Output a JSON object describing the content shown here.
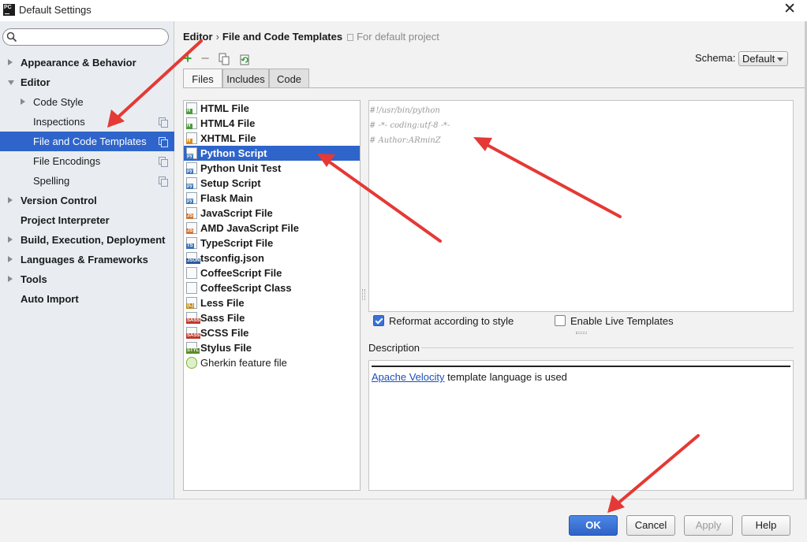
{
  "window": {
    "title": "Default Settings",
    "app_icon_text": "PC"
  },
  "search": {
    "placeholder": "",
    "value": ""
  },
  "sidebar": {
    "items": [
      {
        "label": "Appearance & Behavior",
        "level": 0,
        "expander": "right"
      },
      {
        "label": "Editor",
        "level": 0,
        "expander": "down"
      },
      {
        "label": "Code Style",
        "level": 1,
        "expander": "right"
      },
      {
        "label": "Inspections",
        "level": 1,
        "expander": "none",
        "copy_icon": true
      },
      {
        "label": "File and Code Templates",
        "level": 1,
        "expander": "none",
        "copy_icon": true,
        "selected": true
      },
      {
        "label": "File Encodings",
        "level": 1,
        "expander": "none",
        "copy_icon": true
      },
      {
        "label": "Spelling",
        "level": 1,
        "expander": "none",
        "copy_icon": true
      },
      {
        "label": "Version Control",
        "level": 0,
        "expander": "right"
      },
      {
        "label": "Project Interpreter",
        "level": 0,
        "expander": "none"
      },
      {
        "label": "Build, Execution, Deployment",
        "level": 0,
        "expander": "right"
      },
      {
        "label": "Languages & Frameworks",
        "level": 0,
        "expander": "right"
      },
      {
        "label": "Tools",
        "level": 0,
        "expander": "right"
      },
      {
        "label": "Auto Import",
        "level": 0,
        "expander": "none"
      }
    ]
  },
  "breadcrumb": {
    "parent": "Editor",
    "separator": "›",
    "current": "File and Code Templates",
    "hint": "For default project"
  },
  "toolbar": {
    "add": "+",
    "remove": "−"
  },
  "schema": {
    "label": "Schema:",
    "value": "Default"
  },
  "tabs": [
    {
      "label": "Files",
      "active": true
    },
    {
      "label": "Includes",
      "active": false
    },
    {
      "label": "Code",
      "active": false
    }
  ],
  "files": [
    {
      "name": "HTML File",
      "tag": "H",
      "tag_color": "#4c9a3c"
    },
    {
      "name": "HTML4 File",
      "tag": "H",
      "tag_color": "#4c9a3c"
    },
    {
      "name": "XHTML File",
      "tag": "H",
      "tag_color": "#d98b1e"
    },
    {
      "name": "Python Script",
      "tag": "py",
      "tag_color": "#3d75b8",
      "selected": true
    },
    {
      "name": "Python Unit Test",
      "tag": "py",
      "tag_color": "#3d75b8"
    },
    {
      "name": "Setup Script",
      "tag": "py",
      "tag_color": "#3d75b8"
    },
    {
      "name": "Flask Main",
      "tag": "py",
      "tag_color": "#3d75b8"
    },
    {
      "name": "JavaScript File",
      "tag": "JS",
      "tag_color": "#d0763a"
    },
    {
      "name": "AMD JavaScript File",
      "tag": "JS",
      "tag_color": "#d0763a"
    },
    {
      "name": "TypeScript File",
      "tag": "TS",
      "tag_color": "#3d75b8"
    },
    {
      "name": "tsconfig.json",
      "tag": "JSON",
      "tag_color": "#2b5a9e"
    },
    {
      "name": "CoffeeScript File",
      "tag": "",
      "tag_color": "#555555"
    },
    {
      "name": "CoffeeScript Class",
      "tag": "",
      "tag_color": "#555555"
    },
    {
      "name": "Less File",
      "tag": "{L}",
      "tag_color": "#c08a1a"
    },
    {
      "name": "Sass File",
      "tag": "SASS",
      "tag_color": "#c0392b"
    },
    {
      "name": "SCSS File",
      "tag": "SASS",
      "tag_color": "#c0392b"
    },
    {
      "name": "Stylus File",
      "tag": "STYL",
      "tag_color": "#5a8a2a"
    },
    {
      "name": "Gherkin feature file",
      "tag": "",
      "tag_color": "#7cb342",
      "plain": true
    }
  ],
  "editor": {
    "lines": [
      "#!/usr/bin/python",
      "# -*- coding:utf-8 -*-",
      "# Author:ARminZ"
    ]
  },
  "options": {
    "reformat": {
      "label": "Reformat according to style",
      "checked": true
    },
    "live_templates": {
      "label": "Enable Live Templates",
      "checked": false
    }
  },
  "description": {
    "title": "Description",
    "link": "Apache Velocity",
    "text": "template language is used"
  },
  "buttons": {
    "ok": "OK",
    "cancel": "Cancel",
    "apply": "Apply",
    "help": "Help"
  },
  "colors": {
    "selection": "#2f65ca",
    "annotation_arrow": "#e53935"
  }
}
